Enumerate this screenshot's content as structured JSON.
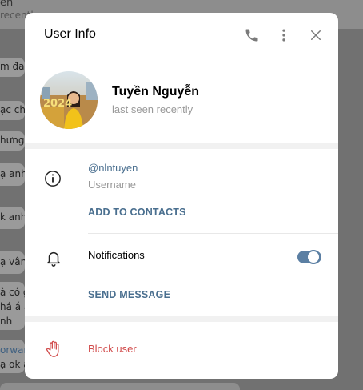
{
  "background": {
    "top_line_1": "ển",
    "top_line_2": "recentl",
    "bubbles": [
      "m đan",
      "ạc chú",
      "hưng",
      "ạ anh",
      "k anh",
      "ạ vân,",
      "à có g",
      "há á a",
      "nh",
      "orwar",
      "ạ ok a"
    ]
  },
  "dialog": {
    "title": "User Info",
    "header_icons": [
      "phone-icon",
      "more-vertical-icon",
      "close-icon"
    ]
  },
  "profile": {
    "name": "Tuyền Nguyễn",
    "status": "last seen recently",
    "avatar_text": "2024"
  },
  "info": {
    "username": "@nlntuyen",
    "username_label": "Username",
    "add_contacts": "ADD TO CONTACTS"
  },
  "notifications": {
    "label": "Notifications",
    "enabled": true,
    "send_message": "SEND MESSAGE"
  },
  "block": {
    "label": "Block user"
  },
  "colors": {
    "accent": "#4a6f8f",
    "toggle": "#5b7fa3",
    "danger": "#d14b4b"
  }
}
